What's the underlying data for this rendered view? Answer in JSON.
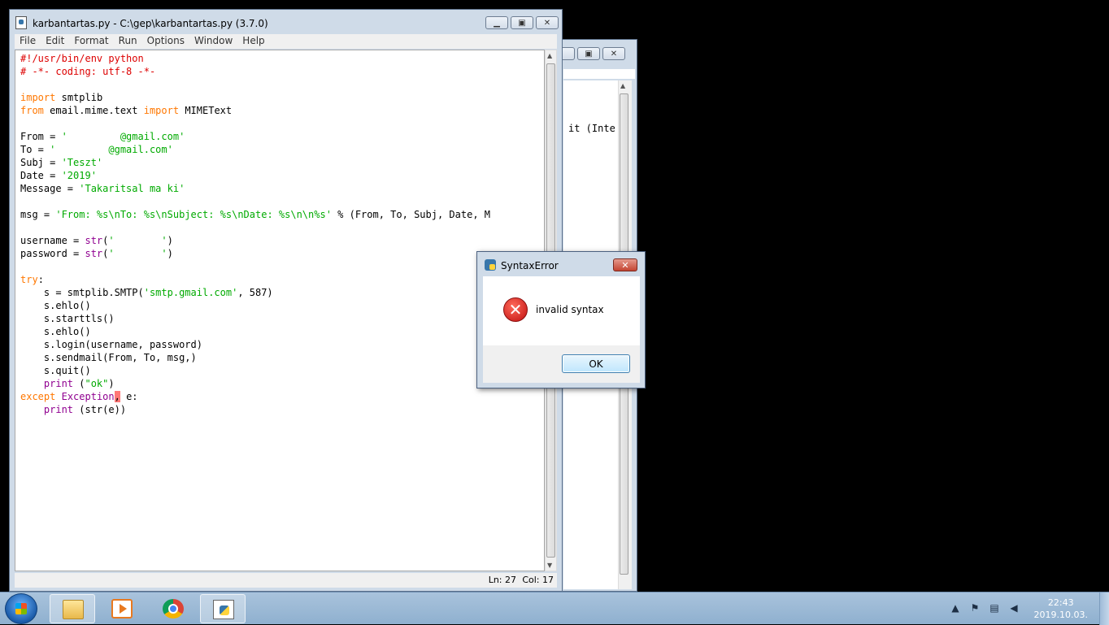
{
  "shell_window": {
    "text_fragment": "it (Inte"
  },
  "editor": {
    "title": "karbantartas.py - C:\\gep\\karbantartas.py (3.7.0)",
    "menu": [
      "File",
      "Edit",
      "Format",
      "Run",
      "Options",
      "Window",
      "Help"
    ],
    "status_ln": "Ln: 27",
    "status_col": "Col: 17",
    "code": [
      {
        "k": "cm",
        "t": "#!/usr/bin/env python"
      },
      {
        "k": "cm",
        "t": "# -*- coding: utf-8 -*-"
      },
      {
        "k": "",
        "t": ""
      },
      {
        "k": "import",
        "t": "smtplib"
      },
      {
        "k": "from",
        "t": "email.mime.text import MIMEText"
      },
      {
        "k": "",
        "t": ""
      },
      {
        "k": "assign",
        "t": "From = ",
        "s": "'         @gmail.com'"
      },
      {
        "k": "assign",
        "t": "To = ",
        "s": "'         @gmail.com'"
      },
      {
        "k": "assign",
        "t": "Subj = ",
        "s": "'Teszt'"
      },
      {
        "k": "assign",
        "t": "Date = ",
        "s": "'2019'"
      },
      {
        "k": "assign",
        "t": "Message = ",
        "s": "'Takaritsal ma ki'"
      },
      {
        "k": "",
        "t": ""
      },
      {
        "k": "msg",
        "t": "msg = ",
        "s": "'From: %s\\nTo: %s\\nSubject: %s\\nDate: %s\\n\\n%s'",
        "r": " % (From, To, Subj, Date, M"
      },
      {
        "k": "",
        "t": ""
      },
      {
        "k": "str",
        "t": "username = ",
        "s": "'        '"
      },
      {
        "k": "str",
        "t": "password = ",
        "s": "'        '"
      },
      {
        "k": "",
        "t": ""
      },
      {
        "k": "try",
        "t": "try:"
      },
      {
        "k": "smtp",
        "t": "    s = smtplib.SMTP(",
        "s": "'smtp.gmail.com'",
        "r": ", 587)"
      },
      {
        "k": "",
        "t": "    s.ehlo()"
      },
      {
        "k": "",
        "t": "    s.starttls()"
      },
      {
        "k": "",
        "t": "    s.ehlo()"
      },
      {
        "k": "",
        "t": "    s.login(username, password)"
      },
      {
        "k": "",
        "t": "    s.sendmail(From, To, msg,)"
      },
      {
        "k": "",
        "t": "    s.quit()"
      },
      {
        "k": "print",
        "t": "    ",
        "s": "\"ok\""
      },
      {
        "k": "except",
        "t": "except"
      },
      {
        "k": "print2",
        "t": "    "
      }
    ],
    "kw_import": "import",
    "kw_from": "from",
    "kw_try": "try",
    "kw_except": "except",
    "kw_print": "print",
    "bi_str": "str",
    "bi_exception": "Exception",
    "tok_comma": ",",
    "tok_e": " e:",
    "tok_str_e": " (str(e))",
    "tok_print_ok_open": " (",
    "tok_print_ok_close": ")"
  },
  "dialog": {
    "title": "SyntaxError",
    "message": "invalid syntax",
    "ok_label": "OK",
    "close_glyph": "✕",
    "error_glyph": "✕"
  },
  "taskbar": {
    "time": "22:43",
    "date": "2019.10.03.",
    "tray_arrow": "▲"
  }
}
